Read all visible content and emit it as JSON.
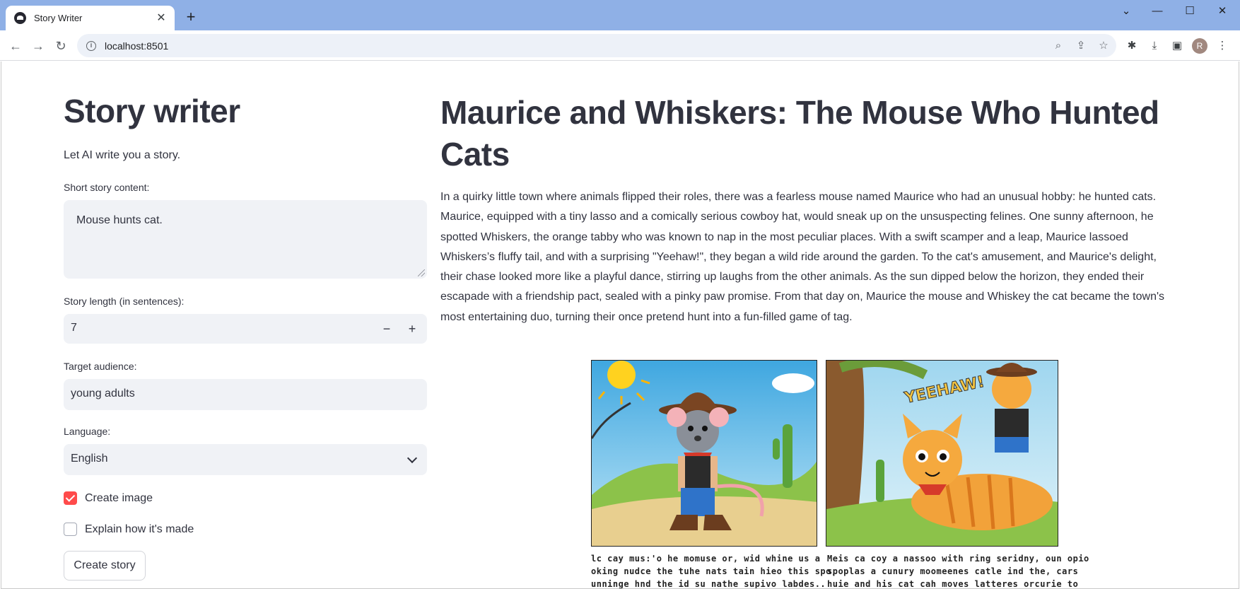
{
  "browser": {
    "tab_title": "Story Writer",
    "url": "localhost:8501",
    "profile_initial": "R"
  },
  "sidebar": {
    "title": "Story writer",
    "subtitle": "Let AI write you a story.",
    "content_label": "Short story content:",
    "content_value": "Mouse hunts cat.",
    "length_label": "Story length (in sentences):",
    "length_value": "7",
    "audience_label": "Target audience:",
    "audience_value": "young adults",
    "language_label": "Language:",
    "language_value": "English",
    "create_image_label": "Create image",
    "create_image_checked": true,
    "explain_label": "Explain how it's made",
    "explain_checked": false,
    "submit_label": "Create story"
  },
  "story": {
    "title": "Maurice and Whiskers: The Mouse Who Hunted Cats",
    "body": "In a quirky little town where animals flipped their roles, there was a fearless mouse named Maurice who had an unusual hobby: he hunted cats. Maurice, equipped with a tiny lasso and a comically serious cowboy hat, would sneak up on the unsuspecting felines. One sunny afternoon, he spotted Whiskers, the orange tabby who was known to nap in the most peculiar places. With a swift scamper and a leap, Maurice lassoed Whiskers’s fluffy tail, and with a surprising \"Yeehaw!\", they began a wild ride around the garden. To the cat's amusement, and Maurice's delight, their chase looked more like a playful dance, stirring up laughs from the other animals. As the sun dipped below the horizon, they ended their escapade with a friendship pact, sealed with a pinky paw promise. From that day on, Maurice the mouse and Whiskey the cat became the town's most entertaining duo, turning their once pretend hunt into a fun-filled game of tag.",
    "image": {
      "speech_text": "YEEHAW!",
      "caption_left": "lc cay mus:'o he momuse or, wid whine us a\noking nudce the tuhe nats tain hieo this spo,\nunninge hnd the id su nathe supivo labdes..",
      "caption_right": "Meis ca coy a nassoo with ring seridny, oun opio\nspoplas a cunury moomeenes catle ind the, cars\nhuie and his cat cah moves latteres orcurie to"
    }
  },
  "colors": {
    "accent": "#ff4b4b",
    "text": "#31333f",
    "input_bg": "#f0f2f6",
    "tabstrip": "#8fb0e6"
  }
}
